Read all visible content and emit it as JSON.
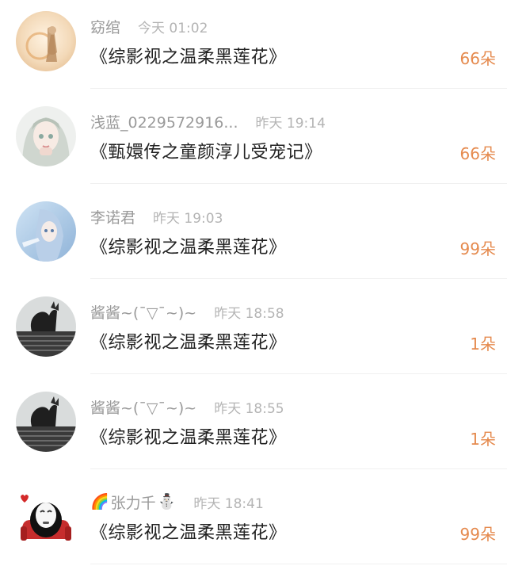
{
  "entries": [
    {
      "user": "窈绾",
      "user_prefix": "",
      "user_suffix": "",
      "time": "今天 01:02",
      "title": "《综影视之温柔黑莲花》",
      "flowers": "66朵",
      "avatar_icon": "avatar-girl-golden-icon"
    },
    {
      "user": "浅蓝_0229572916...",
      "user_prefix": "",
      "user_suffix": "",
      "time": "昨天 19:14",
      "title": "《甄嬛传之童颜淳儿受宠记》",
      "flowers": "66朵",
      "avatar_icon": "avatar-anime-girl-icon"
    },
    {
      "user": "李诺君",
      "user_prefix": "",
      "user_suffix": "",
      "time": "昨天 19:03",
      "title": "《综影视之温柔黑莲花》",
      "flowers": "99朵",
      "avatar_icon": "avatar-blue-anime-girl-icon"
    },
    {
      "user": "酱酱~(ˉ▽ˉ~)~",
      "user_prefix": "",
      "user_suffix": "",
      "time": "昨天 18:58",
      "title": "《综影视之温柔黑莲花》",
      "flowers": "1朵",
      "avatar_icon": "avatar-dark-photo-icon"
    },
    {
      "user": "酱酱~(ˉ▽ˉ~)~",
      "user_prefix": "",
      "user_suffix": "",
      "time": "昨天 18:55",
      "title": "《综影视之温柔黑莲花》",
      "flowers": "1朵",
      "avatar_icon": "avatar-dark-photo-icon"
    },
    {
      "user": "张力千",
      "user_prefix": "🌈",
      "user_suffix": "⛄",
      "time": "昨天 18:41",
      "title": "《综影视之温柔黑莲花》",
      "flowers": "99朵",
      "avatar_icon": "avatar-no-face-icon"
    }
  ],
  "colors": {
    "flowers": "#e58a4e",
    "username": "#9a9a9a",
    "time": "#b4b4b4",
    "title": "#222222"
  }
}
